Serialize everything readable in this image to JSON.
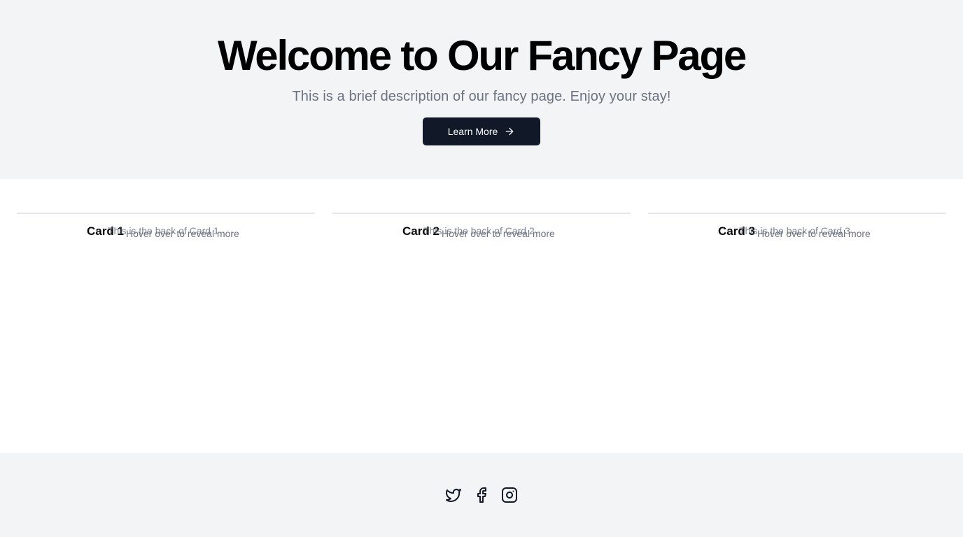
{
  "hero": {
    "title": "Welcome to Our Fancy Page",
    "description": "This is a brief description of our fancy page. Enjoy your stay!",
    "cta_label": "Learn More",
    "cta_icon": "arrow-right-icon"
  },
  "cards": [
    {
      "title": "Card 1",
      "back_text": "This is the back of Card 1",
      "hint": "Hover over to reveal more"
    },
    {
      "title": "Card 2",
      "back_text": "This is the back of Card 2",
      "hint": "Hover over to reveal more"
    },
    {
      "title": "Card 3",
      "back_text": "This is the back of Card 3",
      "hint": "Hover over to reveal more"
    }
  ],
  "footer": {
    "social": [
      {
        "name": "Twitter",
        "icon": "twitter-icon"
      },
      {
        "name": "Facebook",
        "icon": "facebook-icon"
      },
      {
        "name": "Instagram",
        "icon": "instagram-icon"
      }
    ]
  },
  "colors": {
    "hero_bg": "#f3f4f6",
    "button_bg": "#111827",
    "muted_text": "#6b7280",
    "card_border": "#e5e7eb"
  }
}
